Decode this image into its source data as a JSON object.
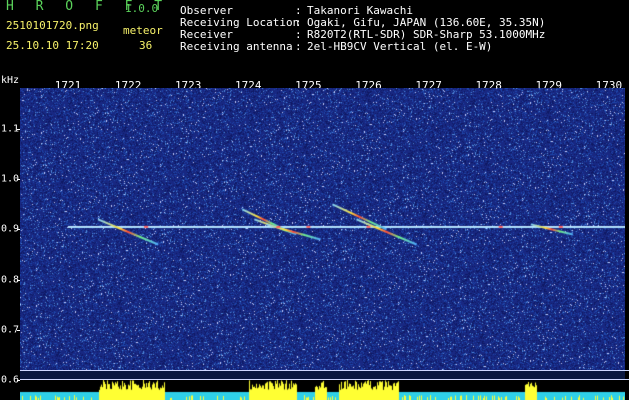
{
  "header": {
    "app_name": "H R O F F T",
    "version": "1.0.0",
    "filename": "2510101720.png",
    "datetime": "25.10.10 17:20",
    "event_label": "meteor",
    "event_count": "36",
    "fields": [
      {
        "label": "Observer",
        "value": "Takanori Kawachi"
      },
      {
        "label": "Receiving Location",
        "value": "Ogaki, Gifu, JAPAN (136.60E, 35.35N)"
      },
      {
        "label": "Receiver",
        "value": "R820T2(RTL-SDR) SDR-Sharp 53.1000MHz"
      },
      {
        "label": "Receiving antenna",
        "value": "2el-HB9CV Vertical (el. E-W)"
      }
    ],
    "colors": {
      "title": "#5bd35b",
      "meta": "#f7f26a",
      "text": "#ffffff"
    }
  },
  "axes": {
    "y_unit": "kHz",
    "x_ticks": [
      "1721",
      "1722",
      "1723",
      "1724",
      "1725",
      "1726",
      "1727",
      "1728",
      "1729",
      "1730"
    ],
    "y_ticks": [
      "1.1",
      "1.0",
      "0.9",
      "0.8",
      "0.7",
      "0.6"
    ]
  },
  "spectrogram": {
    "background": "#1a2b8a",
    "carrier_frequency_khz": 0.905,
    "meteor_echoes": [
      {
        "x_start": 1721.5,
        "x_end": 1722.5,
        "f_start": 0.92,
        "f_end": 0.87
      },
      {
        "x_start": 1724.1,
        "x_end": 1724.8,
        "f_start": 0.92,
        "f_end": 0.89
      },
      {
        "x_start": 1723.9,
        "x_end": 1724.6,
        "f_start": 0.94,
        "f_end": 0.9
      },
      {
        "x_start": 1724.3,
        "x_end": 1725.2,
        "f_start": 0.91,
        "f_end": 0.88
      },
      {
        "x_start": 1725.4,
        "x_end": 1726.3,
        "f_start": 0.95,
        "f_end": 0.9
      },
      {
        "x_start": 1725.8,
        "x_end": 1726.8,
        "f_start": 0.92,
        "f_end": 0.87
      },
      {
        "x_start": 1728.7,
        "x_end": 1729.4,
        "f_start": 0.91,
        "f_end": 0.89
      }
    ]
  }
}
